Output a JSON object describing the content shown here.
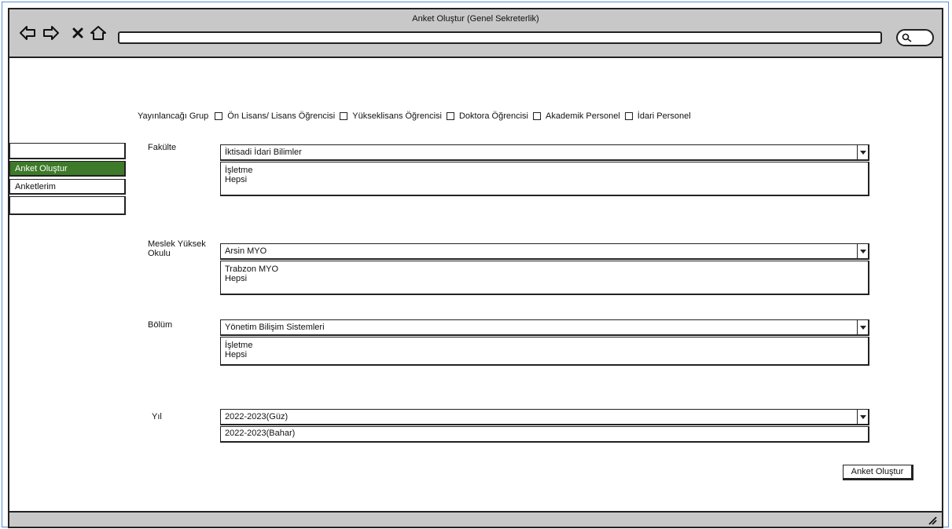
{
  "window": {
    "title": "Anket Oluştur (Genel Sekreterlik)"
  },
  "browser": {
    "address": ""
  },
  "sidebar": {
    "items": [
      {
        "label": "Anket Oluştur",
        "active": true
      },
      {
        "label": "Anketlerim",
        "active": false
      }
    ]
  },
  "publish_group": {
    "label": "Yayınlancağı Grup",
    "options": [
      {
        "label": "Ön Lisans/ Lisans Öğrencisi",
        "checked": false
      },
      {
        "label": "Yükseklisans Öğrencisi",
        "checked": false
      },
      {
        "label": "Doktora Öğrencisi",
        "checked": false
      },
      {
        "label": "Akademik Personel",
        "checked": false
      },
      {
        "label": "İdari Personel",
        "checked": false
      }
    ]
  },
  "faculty": {
    "label": "Fakülte",
    "selected": "İktisadi İdari Bilimler",
    "options": [
      "İşletme",
      "Hepsi"
    ]
  },
  "vocational": {
    "label_line1": "Meslek Yüksek",
    "label_line2": "Okulu",
    "selected": "Arsin MYO",
    "options": [
      "Trabzon MYO",
      "Hepsi"
    ]
  },
  "department": {
    "label": "Bölüm",
    "selected": "Yönetim Bilişim Sistemleri",
    "options": [
      "İşletme",
      "Hepsi"
    ]
  },
  "year": {
    "label": "Yıl",
    "selected": "2022-2023(Güz)",
    "options": [
      "2022-2023(Bahar)"
    ]
  },
  "actions": {
    "create_label": "Anket Oluştur"
  },
  "colors": {
    "active_nav": "#3d7a29",
    "chrome": "#c8c8c8",
    "frame": "#5a8fd0"
  }
}
